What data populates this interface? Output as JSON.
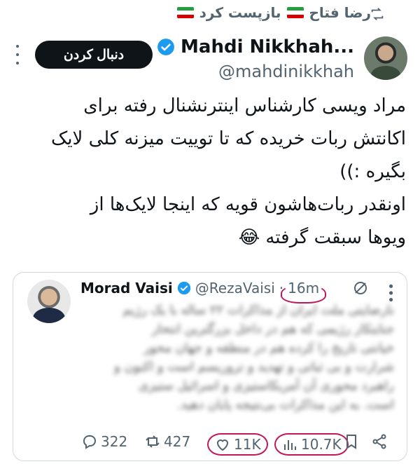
{
  "repost": {
    "text": "رضا فتاح 🇮🇷 بازپست کرد",
    "name": "رضا فتاح",
    "suffix": "بازپست کرد"
  },
  "author": {
    "display_name": "Mahdi Nikkhah...",
    "handle": "@mahdinikkhah",
    "verified": true
  },
  "follow_button": {
    "label": "دنبال کردن"
  },
  "tweet": {
    "lines": [
      "مراد ویسی کارشناس اینترنشنال رفته برای",
      "اکانتش ربات خریده که تا توییت میزنه کلی لایک",
      "بگیره :))",
      "اونقدر ربات‌هاشون قویه که اینجا لایک‌ها از",
      "ویوها سبقت گرفته 😂"
    ]
  },
  "quoted": {
    "display_name": "Morad Vaisi",
    "handle": "@RezaVaisi",
    "dot": "·",
    "time": "16m",
    "lines_clear_first": "نارضایتی ملت ایران از مذاکرات",
    "lines": [
      "نارضایتی ملت ایران از مذاکرات ۲۲ ساله با یک رژیم",
      "جنایتکار رژیمی که هم در داخل بزرگترین انتحار",
      "خیانتی تاریخ را کرده هم در منطقه و جهان محور",
      "شرارت و بی ثباتی و تهدید و تروریسم است و اکنون و",
      "راهبرد محوری آن آمریکاستیزی و اسرائیل ستیزی",
      "است. به این مذاکرات بی‌نتیجه پایان دهید."
    ],
    "last_clear": "است. به این مذاکرات بی‌نتیجه پایان دهید."
  },
  "actions": {
    "replies": "322",
    "reposts": "427",
    "likes": "11K",
    "views": "10.7K"
  },
  "colors": {
    "accent": "#1d9bf0",
    "highlight": "#c2185b",
    "text": "#0f1419",
    "muted": "#536471"
  }
}
